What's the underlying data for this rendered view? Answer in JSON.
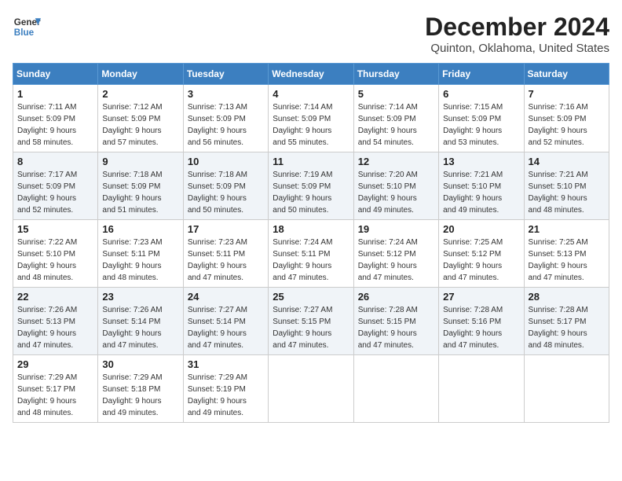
{
  "logo": {
    "line1": "General",
    "line2": "Blue"
  },
  "title": "December 2024",
  "location": "Quinton, Oklahoma, United States",
  "days_of_week": [
    "Sunday",
    "Monday",
    "Tuesday",
    "Wednesday",
    "Thursday",
    "Friday",
    "Saturday"
  ],
  "weeks": [
    [
      {
        "day": "1",
        "sunrise": "7:11 AM",
        "sunset": "5:09 PM",
        "daylight": "9 hours and 58 minutes."
      },
      {
        "day": "2",
        "sunrise": "7:12 AM",
        "sunset": "5:09 PM",
        "daylight": "9 hours and 57 minutes."
      },
      {
        "day": "3",
        "sunrise": "7:13 AM",
        "sunset": "5:09 PM",
        "daylight": "9 hours and 56 minutes."
      },
      {
        "day": "4",
        "sunrise": "7:14 AM",
        "sunset": "5:09 PM",
        "daylight": "9 hours and 55 minutes."
      },
      {
        "day": "5",
        "sunrise": "7:14 AM",
        "sunset": "5:09 PM",
        "daylight": "9 hours and 54 minutes."
      },
      {
        "day": "6",
        "sunrise": "7:15 AM",
        "sunset": "5:09 PM",
        "daylight": "9 hours and 53 minutes."
      },
      {
        "day": "7",
        "sunrise": "7:16 AM",
        "sunset": "5:09 PM",
        "daylight": "9 hours and 52 minutes."
      }
    ],
    [
      {
        "day": "8",
        "sunrise": "7:17 AM",
        "sunset": "5:09 PM",
        "daylight": "9 hours and 52 minutes."
      },
      {
        "day": "9",
        "sunrise": "7:18 AM",
        "sunset": "5:09 PM",
        "daylight": "9 hours and 51 minutes."
      },
      {
        "day": "10",
        "sunrise": "7:18 AM",
        "sunset": "5:09 PM",
        "daylight": "9 hours and 50 minutes."
      },
      {
        "day": "11",
        "sunrise": "7:19 AM",
        "sunset": "5:09 PM",
        "daylight": "9 hours and 50 minutes."
      },
      {
        "day": "12",
        "sunrise": "7:20 AM",
        "sunset": "5:10 PM",
        "daylight": "9 hours and 49 minutes."
      },
      {
        "day": "13",
        "sunrise": "7:21 AM",
        "sunset": "5:10 PM",
        "daylight": "9 hours and 49 minutes."
      },
      {
        "day": "14",
        "sunrise": "7:21 AM",
        "sunset": "5:10 PM",
        "daylight": "9 hours and 48 minutes."
      }
    ],
    [
      {
        "day": "15",
        "sunrise": "7:22 AM",
        "sunset": "5:10 PM",
        "daylight": "9 hours and 48 minutes."
      },
      {
        "day": "16",
        "sunrise": "7:23 AM",
        "sunset": "5:11 PM",
        "daylight": "9 hours and 48 minutes."
      },
      {
        "day": "17",
        "sunrise": "7:23 AM",
        "sunset": "5:11 PM",
        "daylight": "9 hours and 47 minutes."
      },
      {
        "day": "18",
        "sunrise": "7:24 AM",
        "sunset": "5:11 PM",
        "daylight": "9 hours and 47 minutes."
      },
      {
        "day": "19",
        "sunrise": "7:24 AM",
        "sunset": "5:12 PM",
        "daylight": "9 hours and 47 minutes."
      },
      {
        "day": "20",
        "sunrise": "7:25 AM",
        "sunset": "5:12 PM",
        "daylight": "9 hours and 47 minutes."
      },
      {
        "day": "21",
        "sunrise": "7:25 AM",
        "sunset": "5:13 PM",
        "daylight": "9 hours and 47 minutes."
      }
    ],
    [
      {
        "day": "22",
        "sunrise": "7:26 AM",
        "sunset": "5:13 PM",
        "daylight": "9 hours and 47 minutes."
      },
      {
        "day": "23",
        "sunrise": "7:26 AM",
        "sunset": "5:14 PM",
        "daylight": "9 hours and 47 minutes."
      },
      {
        "day": "24",
        "sunrise": "7:27 AM",
        "sunset": "5:14 PM",
        "daylight": "9 hours and 47 minutes."
      },
      {
        "day": "25",
        "sunrise": "7:27 AM",
        "sunset": "5:15 PM",
        "daylight": "9 hours and 47 minutes."
      },
      {
        "day": "26",
        "sunrise": "7:28 AM",
        "sunset": "5:15 PM",
        "daylight": "9 hours and 47 minutes."
      },
      {
        "day": "27",
        "sunrise": "7:28 AM",
        "sunset": "5:16 PM",
        "daylight": "9 hours and 47 minutes."
      },
      {
        "day": "28",
        "sunrise": "7:28 AM",
        "sunset": "5:17 PM",
        "daylight": "9 hours and 48 minutes."
      }
    ],
    [
      {
        "day": "29",
        "sunrise": "7:29 AM",
        "sunset": "5:17 PM",
        "daylight": "9 hours and 48 minutes."
      },
      {
        "day": "30",
        "sunrise": "7:29 AM",
        "sunset": "5:18 PM",
        "daylight": "9 hours and 49 minutes."
      },
      {
        "day": "31",
        "sunrise": "7:29 AM",
        "sunset": "5:19 PM",
        "daylight": "9 hours and 49 minutes."
      },
      null,
      null,
      null,
      null
    ]
  ],
  "labels": {
    "sunrise": "Sunrise:",
    "sunset": "Sunset:",
    "daylight": "Daylight:"
  }
}
